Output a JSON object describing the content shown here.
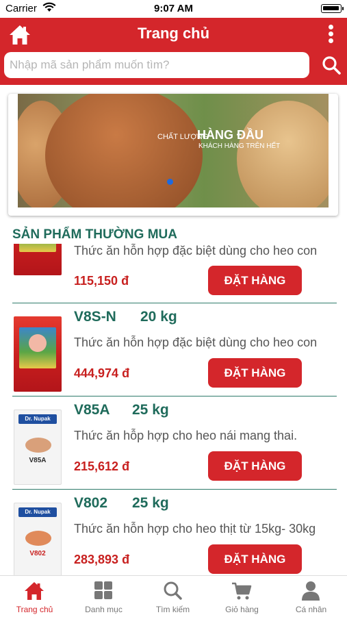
{
  "status_bar": {
    "carrier": "Carrier",
    "time": "9:07 AM"
  },
  "header": {
    "title": "Trang chủ",
    "home_icon": "home-icon",
    "more_icon": "more-vertical-icon"
  },
  "search": {
    "placeholder": "Nhập mã sản phẩm muốn tìm?",
    "value": "",
    "icon": "search-icon"
  },
  "banner": {
    "caption_small": "CHẤT LƯỢNG",
    "caption_big": "HÀNG ĐẦU",
    "caption_sub": "KHÁCH HÀNG TRÊN HẾT",
    "page_indicator": "1"
  },
  "section_title": "SẢN PHẨM THƯỜNG MUA",
  "products": [
    {
      "code": "",
      "weight": "",
      "description": "Thức ăn hỗn hợp đặc biệt dùng cho heo con",
      "price": "115,150 đ",
      "order_label": "ĐẶT HÀNG",
      "package": "red"
    },
    {
      "code": "V8S-N",
      "weight": "20 kg",
      "description": "Thức ăn hỗn hợp đặc biệt dùng cho heo con",
      "price": "444,974 đ",
      "order_label": "ĐẶT HÀNG",
      "package": "red"
    },
    {
      "code": "V85A",
      "weight": "25 kg",
      "description": "Thức ăn hỗp hợp cho heo nái mang thai.",
      "price": "215,612 đ",
      "order_label": "ĐẶT HÀNG",
      "package": "white",
      "package_brand": "Dr. Nupak",
      "package_label": "V85A"
    },
    {
      "code": "V802",
      "weight": "25 kg",
      "description": "Thức ăn hỗn hợp cho heo thịt từ 15kg- 30kg",
      "price": "283,893 đ",
      "order_label": "ĐẶT HÀNG",
      "package": "white",
      "package_brand": "Dr. Nupak",
      "package_label": "V802"
    }
  ],
  "tabs": [
    {
      "label": "Trang chủ",
      "icon": "home-icon",
      "active": true
    },
    {
      "label": "Danh mục",
      "icon": "grid-icon",
      "active": false
    },
    {
      "label": "Tìm kiếm",
      "icon": "search-icon",
      "active": false
    },
    {
      "label": "Giỏ hàng",
      "icon": "cart-icon",
      "active": false
    },
    {
      "label": "Cá nhân",
      "icon": "user-icon",
      "active": false
    }
  ],
  "colors": {
    "primary": "#d4262b",
    "accent_green": "#1f6b5b",
    "price_red": "#c8201f",
    "tab_inactive": "#777777"
  }
}
